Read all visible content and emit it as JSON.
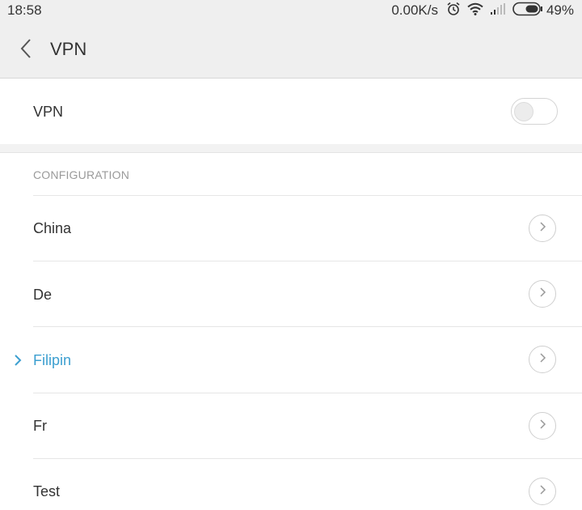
{
  "status_bar": {
    "time": "18:58",
    "speed": "0.00K/s",
    "battery": "49%",
    "icons": [
      "alarm-icon",
      "wifi-icon",
      "signal-icon",
      "battery-icon"
    ]
  },
  "header": {
    "title": "VPN",
    "back_icon": "chevron-left-icon"
  },
  "vpn": {
    "label": "VPN",
    "enabled": false
  },
  "configuration": {
    "header": "CONFIGURATION",
    "items": [
      {
        "label": "China",
        "selected": false
      },
      {
        "label": "De",
        "selected": false
      },
      {
        "label": "Filipin",
        "selected": true
      },
      {
        "label": "Fr",
        "selected": false
      },
      {
        "label": "Test",
        "selected": false
      }
    ]
  },
  "colors": {
    "accent": "#3c9fd0",
    "header_bg": "#efefef",
    "text": "#333333",
    "muted": "#9a9a9a"
  }
}
